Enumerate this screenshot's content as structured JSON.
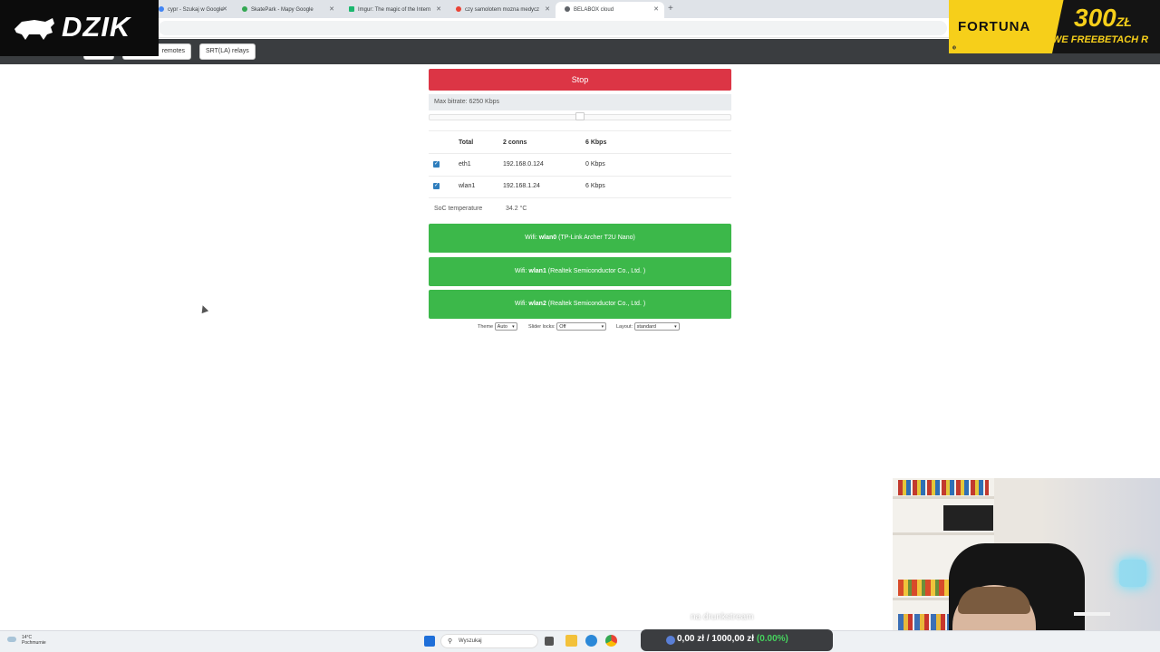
{
  "tabs": [
    {
      "label": "cypr - Szukaj w Google",
      "color": "#4285f4",
      "active": false
    },
    {
      "label": "SkatePark - Mapy Google",
      "color": "#34a853",
      "active": false
    },
    {
      "label": "Imgur: The magic of the Intern",
      "color": "#1bb76e",
      "active": false
    },
    {
      "label": "czy samolotem mozna medycz",
      "color": "#ea4335",
      "active": false
    },
    {
      "label": "BELABOX cloud",
      "color": "#5f6368",
      "active": true
    }
  ],
  "nav": {
    "remotes_label": "remotes",
    "relays_label": "SRT(LA) relays"
  },
  "overlay": {
    "brand": "DZIK",
    "fortuna_name": "FORTUNA",
    "fortuna_amount": "300",
    "fortuna_currency": "ZŁ",
    "fortuna_sub": "WE FREEBETACH R"
  },
  "main": {
    "stop_label": "Stop",
    "bitrate_label": "Max bitrate: 6250 Kbps",
    "bitrate_fraction": 0.5,
    "network": {
      "total": {
        "name": "Total",
        "conns": "2 conns",
        "rate": "6 Kbps"
      },
      "rows": [
        {
          "name": "eth1",
          "ip": "192.168.0.124",
          "rate": "0 Kbps",
          "checked": true
        },
        {
          "name": "wlan1",
          "ip": "192.168.1.24",
          "rate": "6 Kbps",
          "checked": true
        }
      ]
    },
    "soc_label": "SoC temperature",
    "soc_value": "34.2 °C",
    "wifi": [
      {
        "prefix": "Wifi: ",
        "iface": "wlan0",
        "desc": " (TP-Link Archer T2U Nano)"
      },
      {
        "prefix": "Wifi: ",
        "iface": "wlan1",
        "desc": " (Realtek Semiconductor Co., Ltd. )"
      },
      {
        "prefix": "Wifi: ",
        "iface": "wlan2",
        "desc": " (Realtek Semiconductor Co., Ltd. )"
      }
    ],
    "options": {
      "theme_label": "Theme",
      "theme_value": "Auto",
      "slider_label": "Slider locks:",
      "slider_value": "Off",
      "layout_label": "Layout:",
      "layout_value": "standard"
    }
  },
  "taskbar": {
    "weather_temp": "14°C",
    "weather_desc": "Pochmurnie",
    "search_placeholder": "Wyszukaj",
    "balance_left": "0,00 zł",
    "balance_right": "1000,00 zł",
    "balance_pct": "(0.00%)",
    "caption": "na drunkstream"
  },
  "colors": {
    "stop": "#dc3545",
    "wifi": "#3cb84a",
    "checkbox": "#2f7ebd",
    "fortuna": "#f6cf1a"
  }
}
